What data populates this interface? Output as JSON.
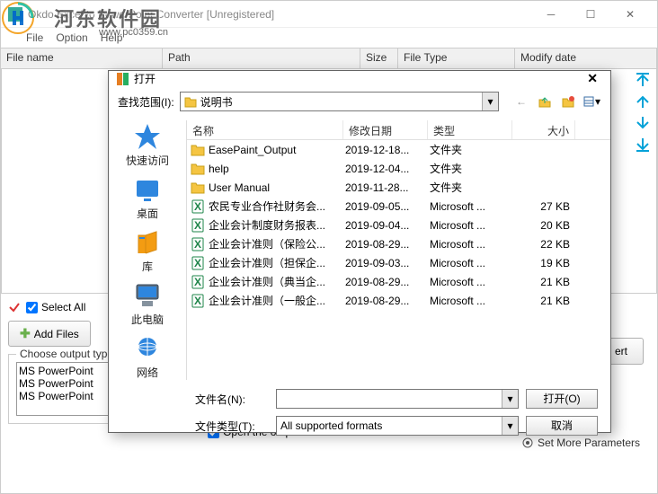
{
  "watermark": {
    "text": "河东软件园",
    "url": "www.pc0359.cn"
  },
  "main": {
    "title": "Okdo Excel to PowerPoint Converter [Unregistered]",
    "menu": {
      "file": "File",
      "option": "Option",
      "help": "Help"
    },
    "grid_headers": {
      "filename": "File name",
      "path": "Path",
      "size": "Size",
      "filetype": "File Type",
      "modify": "Modify date"
    },
    "select_all": "Select All",
    "add_files": "Add Files",
    "choose_output": "Choose output type:",
    "output_items": [
      "MS PowerPoint",
      "MS PowerPoint",
      "MS PowerPoint"
    ],
    "set_more_params": "Set More Parameters",
    "open_output_folder": "Open the output folder after conversion finished",
    "convert_btn": "ert"
  },
  "dialog": {
    "title": "打开",
    "look_in_label": "查找范围(I):",
    "current_folder": "说明书",
    "places": {
      "quick": "快速访问",
      "desktop": "桌面",
      "library": "库",
      "thispc": "此电脑",
      "network": "网络"
    },
    "columns": {
      "name": "名称",
      "date": "修改日期",
      "type": "类型",
      "size": "大小"
    },
    "rows": [
      {
        "icon": "folder",
        "name": "EasePaint_Output",
        "date": "2019-12-18...",
        "type": "文件夹",
        "size": ""
      },
      {
        "icon": "folder",
        "name": "help",
        "date": "2019-12-04...",
        "type": "文件夹",
        "size": ""
      },
      {
        "icon": "folder",
        "name": "User Manual",
        "date": "2019-11-28...",
        "type": "文件夹",
        "size": ""
      },
      {
        "icon": "excel",
        "name": "农民专业合作社财务会...",
        "date": "2019-09-05...",
        "type": "Microsoft ...",
        "size": "27 KB"
      },
      {
        "icon": "excel",
        "name": "企业会计制度财务报表...",
        "date": "2019-09-04...",
        "type": "Microsoft ...",
        "size": "20 KB"
      },
      {
        "icon": "excel",
        "name": "企业会计准则（保险公...",
        "date": "2019-08-29...",
        "type": "Microsoft ...",
        "size": "22 KB"
      },
      {
        "icon": "excel",
        "name": "企业会计准则（担保企...",
        "date": "2019-09-03...",
        "type": "Microsoft ...",
        "size": "19 KB"
      },
      {
        "icon": "excel",
        "name": "企业会计准则（典当企...",
        "date": "2019-08-29...",
        "type": "Microsoft ...",
        "size": "21 KB"
      },
      {
        "icon": "excel",
        "name": "企业会计准则（一般企...",
        "date": "2019-08-29...",
        "type": "Microsoft ...",
        "size": "21 KB"
      }
    ],
    "filename_label": "文件名(N):",
    "filename_value": "",
    "filetype_label": "文件类型(T):",
    "filetype_value": "All supported formats",
    "open_btn": "打开(O)",
    "cancel_btn": "取消"
  }
}
